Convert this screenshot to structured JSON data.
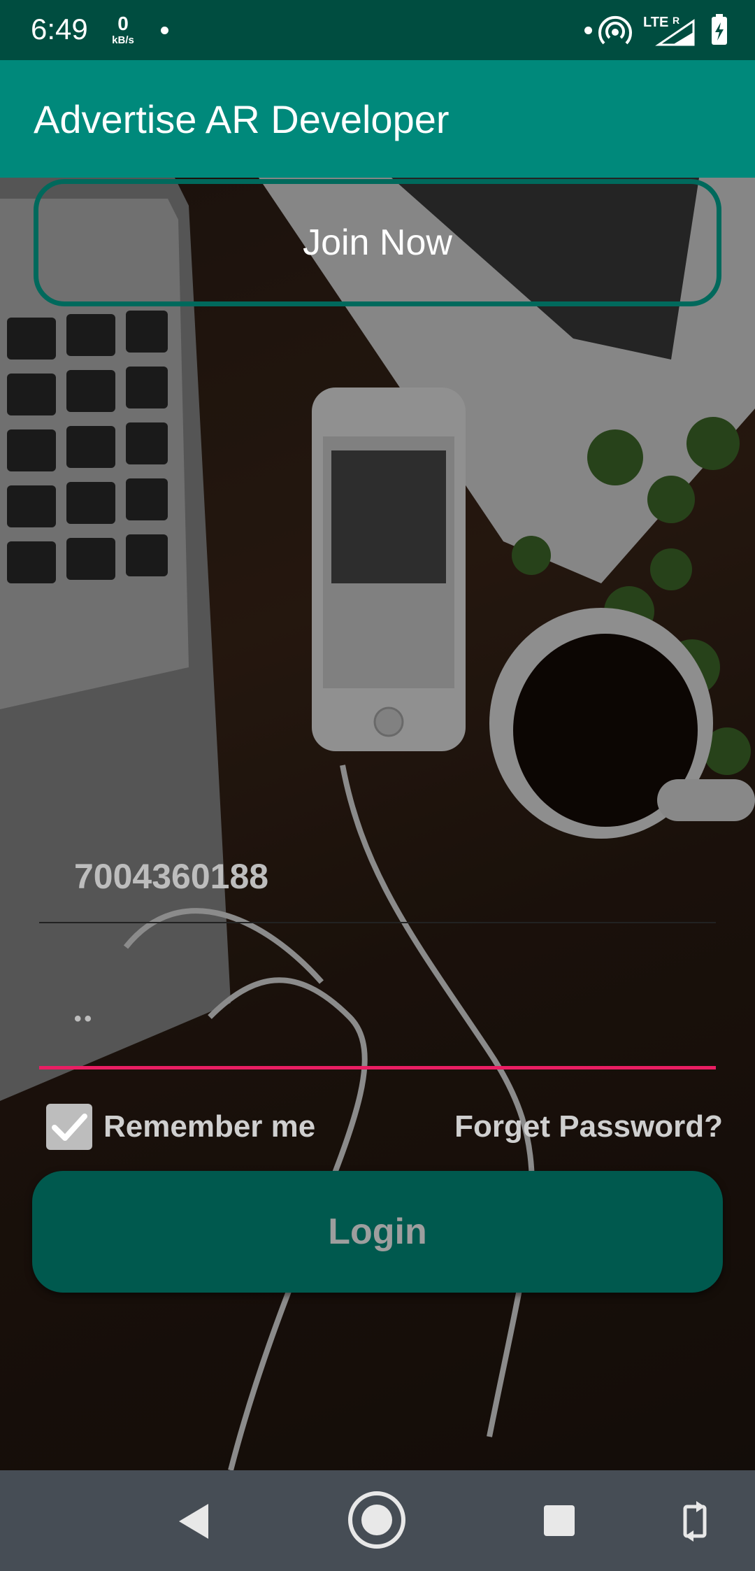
{
  "status_bar": {
    "time": "6:49",
    "speed_value": "0",
    "speed_unit": "kB/s",
    "network": "LTE",
    "roaming": "R"
  },
  "app_bar": {
    "title": "Advertise AR Developer"
  },
  "join": {
    "label": "Join Now"
  },
  "phone_field": {
    "value": "7004360188"
  },
  "password_field": {
    "value": "••"
  },
  "remember": {
    "label": "Remember me",
    "checked": true
  },
  "forget": {
    "label": "Forget Password?"
  },
  "login": {
    "label": "Login"
  },
  "nav": {
    "icons": [
      "back-icon",
      "home-icon",
      "recents-icon",
      "rotate-icon"
    ]
  },
  "colors": {
    "status_bar": "#004d40",
    "app_bar": "#00897b",
    "join_border": "#00695c",
    "login_bg": "#00594e",
    "password_underline": "#e91e63",
    "nav_bar": "#464d55"
  }
}
